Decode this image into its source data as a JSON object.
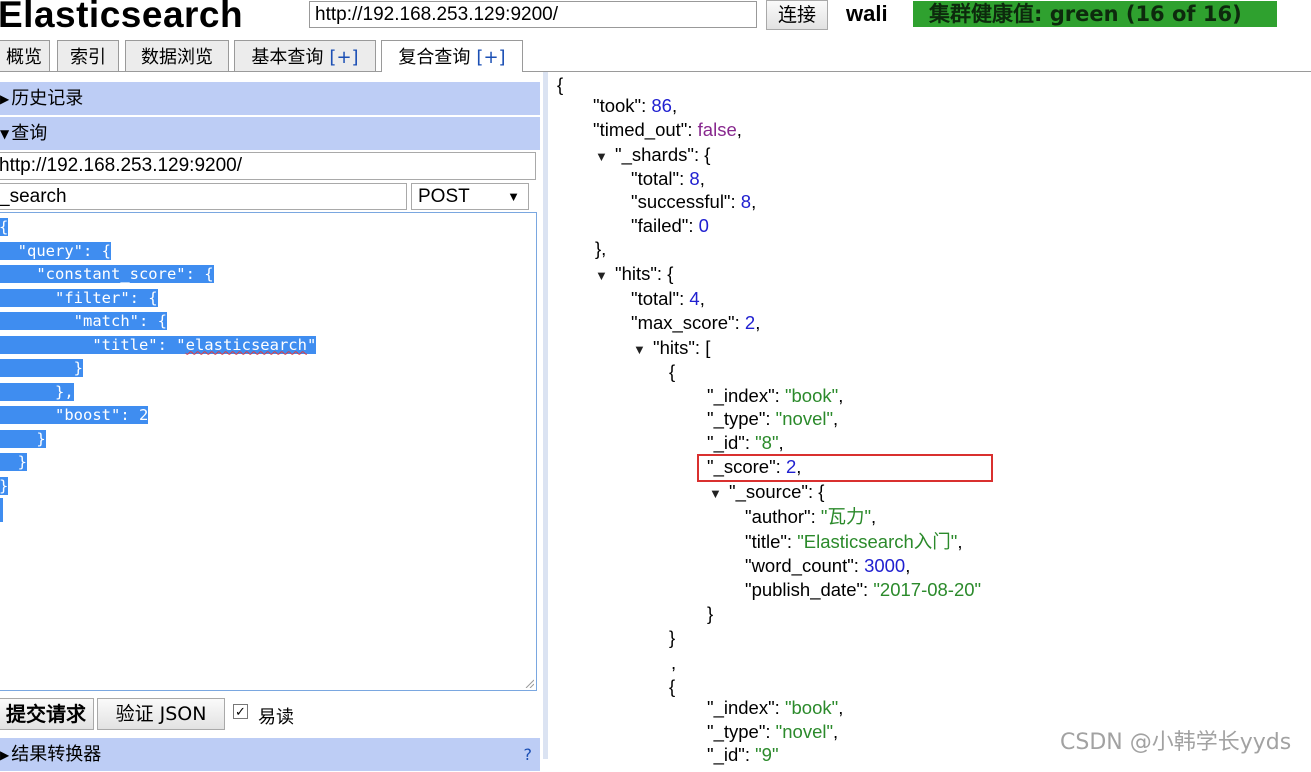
{
  "header": {
    "app_title": "Elasticsearch",
    "connection_url": "http://192.168.253.129:9200/",
    "connect_label": "连接",
    "cluster_name": "wali",
    "cluster_health": "集群健康值: green (16 of 16)",
    "health_color": "#2fa12f"
  },
  "tabs": [
    {
      "label": "概览"
    },
    {
      "label": "索引"
    },
    {
      "label": "数据浏览"
    },
    {
      "label": "基本查询",
      "plus": "[+]"
    },
    {
      "label": "复合查询",
      "plus": "[+]",
      "active": true
    }
  ],
  "left_panel": {
    "history_label": "历史记录",
    "query_label": "查询",
    "request_url": "http://192.168.253.129:9200/",
    "request_path": "_search",
    "method": "POST",
    "body_lines": [
      "{",
      "  \"query\": {",
      "    \"constant_score\": {",
      "      \"filter\": {",
      "        \"match\": {",
      "          \"title\": \"elasticsearch\"",
      "        }",
      "      },",
      "      \"boost\": 2",
      "    }",
      "  }",
      "}"
    ],
    "submit_label": "提交请求",
    "validate_label": "验证 JSON",
    "pretty_label": "易读",
    "pretty_checked": true,
    "transformer_label": "结果转换器",
    "help_label": "?"
  },
  "response": {
    "took": "86",
    "timed_out": "false",
    "shards": {
      "total": "8",
      "successful": "8",
      "failed": "0"
    },
    "hits_total": "4",
    "max_score": "2",
    "hit1": {
      "_index": "\"book\"",
      "_type": "\"novel\"",
      "_id": "\"8\"",
      "_score": "2",
      "author": "\"瓦力\"",
      "title": "\"Elasticsearch入门\"",
      "word_count": "3000",
      "publish_date": "\"2017-08-20\""
    },
    "hit2": {
      "_index": "\"book\"",
      "_type": "\"novel\"",
      "_id": "\"9\""
    }
  },
  "watermark": "CSDN @小韩学长yyds",
  "highlight_color": "#d9302f"
}
